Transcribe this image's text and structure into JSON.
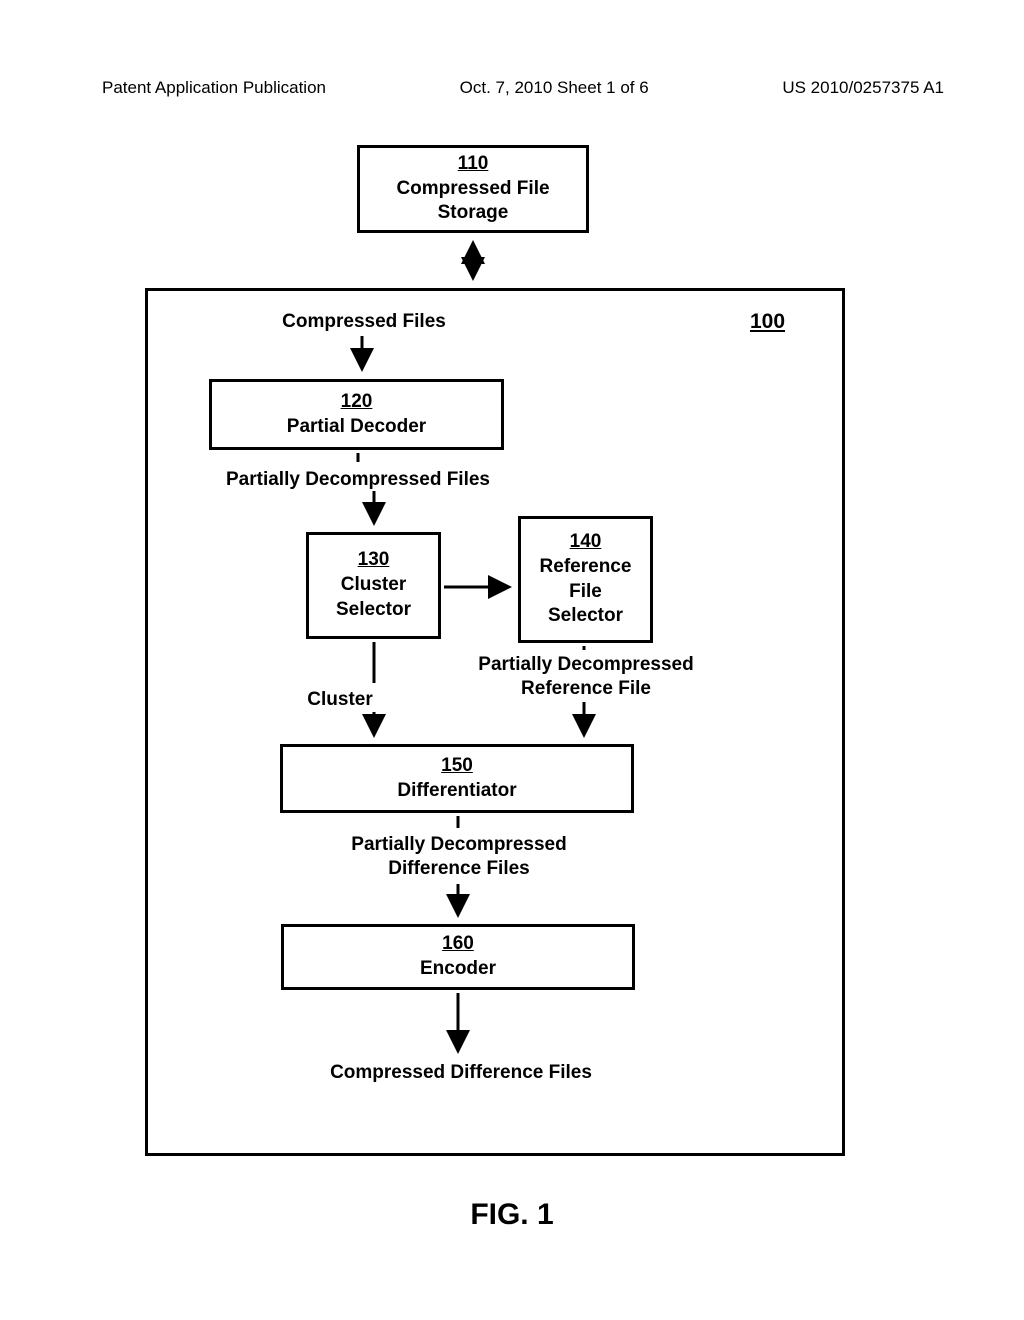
{
  "header": {
    "left": "Patent Application Publication",
    "center": "Oct. 7, 2010  Sheet 1 of 6",
    "right": "US 2010/0257375 A1"
  },
  "system_ref": "100",
  "boxes": {
    "storage": {
      "num": "110",
      "label": "Compressed File\nStorage"
    },
    "decoder": {
      "num": "120",
      "label": "Partial Decoder"
    },
    "cluster_sel": {
      "num": "130",
      "label": "Cluster\nSelector"
    },
    "ref_sel": {
      "num": "140",
      "label": "Reference\nFile\nSelector"
    },
    "diff": {
      "num": "150",
      "label": "Differentiator"
    },
    "encoder": {
      "num": "160",
      "label": "Encoder"
    }
  },
  "labels": {
    "compressed_files": "Compressed Files",
    "partially_decompressed": "Partially Decompressed Files",
    "cluster": "Cluster",
    "pd_ref": "Partially Decompressed\nReference File",
    "pd_diff": "Partially Decompressed\nDifference Files",
    "cd_files": "Compressed Difference Files"
  },
  "figure": "FIG. 1"
}
